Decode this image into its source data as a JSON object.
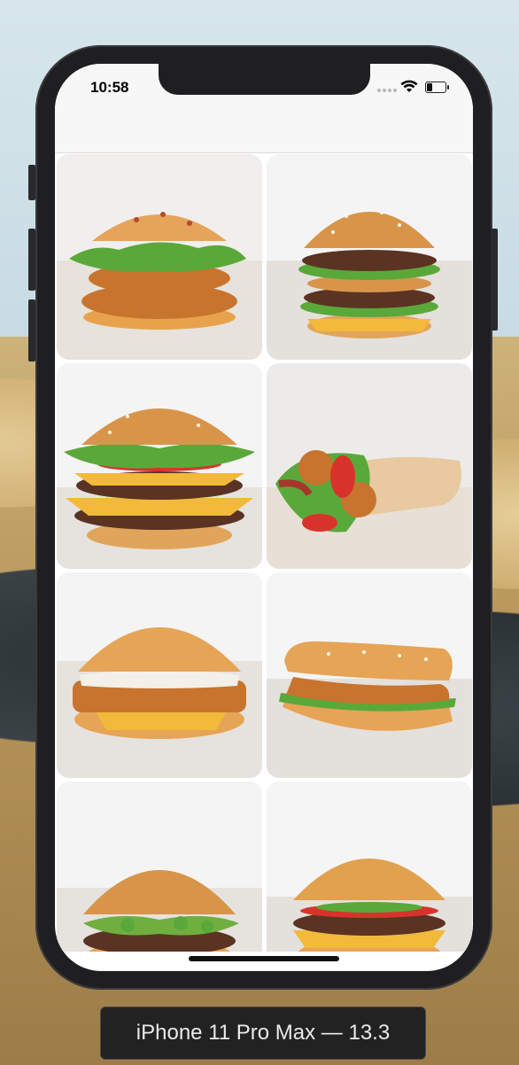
{
  "status_bar": {
    "time": "10:58",
    "icons": [
      "signal-dots-icon",
      "wifi-icon",
      "battery-icon"
    ]
  },
  "grid": {
    "items": [
      {
        "name": "chicken-burger-image"
      },
      {
        "name": "double-burger-image"
      },
      {
        "name": "double-cheeseburger-image"
      },
      {
        "name": "chicken-wrap-image"
      },
      {
        "name": "fish-burger-image"
      },
      {
        "name": "chicken-sub-image"
      },
      {
        "name": "jalapeno-burger-image"
      },
      {
        "name": "cheeseburger-image"
      }
    ]
  },
  "device_label": "iPhone 11 Pro Max — 13.3",
  "colors": {
    "bun": "#d8954a",
    "lettuce": "#5aa83a",
    "patty": "#5a3322",
    "cheese": "#f2b93a",
    "tomato": "#d8332a",
    "crispy": "#c8742e"
  }
}
